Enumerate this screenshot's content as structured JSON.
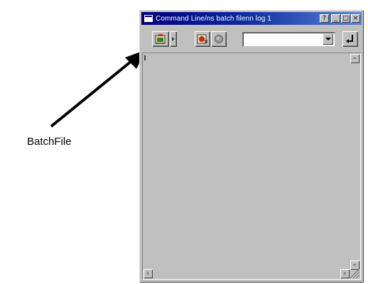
{
  "annotation": {
    "label": "BatchFile"
  },
  "window": {
    "title": "Command Line/ns batch filenn log 1",
    "title_buttons": {
      "help": "?",
      "minimize": "_",
      "maximize": "□",
      "close": "×"
    }
  },
  "toolbar": {
    "buttons": [
      {
        "name": "batch-file-button",
        "icon": "batch-file-icon"
      },
      {
        "name": "dropdown-arrow-button",
        "icon": "small-arrow-icon"
      },
      {
        "name": "run-button",
        "icon": "run-icon"
      },
      {
        "name": "stop-button",
        "icon": "stop-icon"
      }
    ],
    "combo": {
      "value": ""
    },
    "enter_button_icon": "enter-arrow-icon"
  },
  "colors": {
    "title_bar_start": "#00007c",
    "title_bar_end": "#5a86d6",
    "window_face": "#c0c0c0",
    "annotation": "#000000"
  }
}
